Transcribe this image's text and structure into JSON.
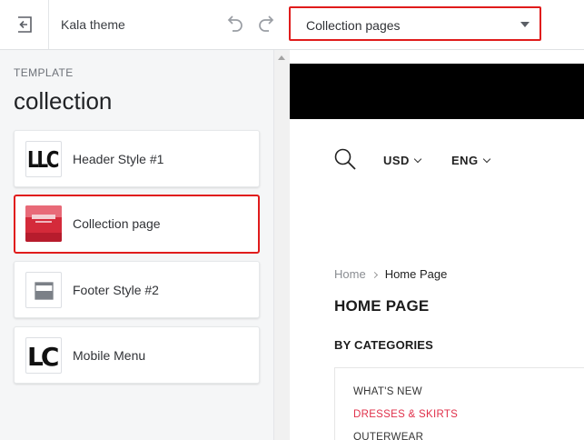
{
  "topbar": {
    "exit_icon": "exit-arrow-icon",
    "theme_name": "Kala theme",
    "undo_icon": "undo-icon",
    "redo_icon": "redo-icon",
    "page_select": {
      "selected": "Collection pages"
    }
  },
  "sidebar": {
    "caption": "TEMPLATE",
    "template_name": "collection",
    "sections": [
      {
        "label": "Header Style #1",
        "thumb_text": "LLC"
      },
      {
        "label": "Collection page",
        "active": true
      },
      {
        "label": "Footer Style #2"
      },
      {
        "label": "Mobile Menu",
        "thumb_text": "LC"
      }
    ]
  },
  "preview": {
    "currency": "USD",
    "language": "ENG",
    "breadcrumb": {
      "home": "Home",
      "current": "Home Page"
    },
    "page_title": "HOME PAGE",
    "categories_heading": "BY CATEGORIES",
    "categories": [
      {
        "label": "WHAT'S NEW",
        "color": "#333333"
      },
      {
        "label": "DRESSES & SKIRTS",
        "color": "#e0304a"
      },
      {
        "label": "OUTERWEAR",
        "color": "#333333"
      }
    ]
  },
  "colors": {
    "highlight": "#e01c1c",
    "sidebar_bg": "#f5f6f7",
    "accent_pink": "#e0304a"
  }
}
